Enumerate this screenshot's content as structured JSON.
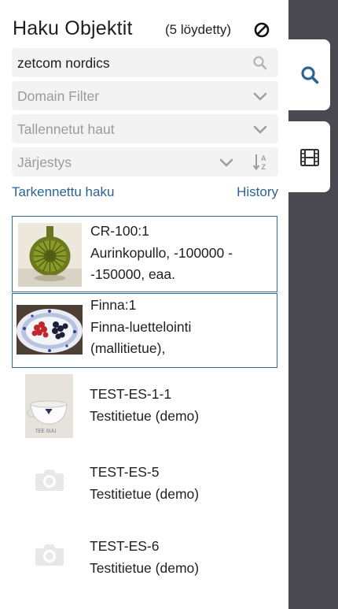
{
  "header": {
    "title": "Haku Objektit",
    "count": "(5 löydetty)",
    "clear_icon": "block-icon"
  },
  "search": {
    "value": "zetcom nordics",
    "icon": "search-icon"
  },
  "filters": {
    "domain_placeholder": "Domain Filter",
    "saved_placeholder": "Tallennetut haut",
    "sort_placeholder": "Järjestys",
    "chevron_icon": "chevron-down-icon",
    "sort_icon": "sort-alpha-icon"
  },
  "links": {
    "advanced": "Tarkennettu haku",
    "history": "History"
  },
  "results": [
    {
      "id": "CR-100:1",
      "line1": "Aurinkopullo, -100000 -",
      "line2": "-150000, eaa.",
      "selected": true,
      "thumb": "green-bottle"
    },
    {
      "id": "Finna:1",
      "line1": "Finna-luettelointi",
      "line2": "(mallitietue),",
      "selected": true,
      "thumb": "berries-plate"
    },
    {
      "id": "TEST-ES-1-1",
      "line1": "Testitietue (demo)",
      "line2": "",
      "selected": false,
      "thumb": "teacup"
    },
    {
      "id": "TEST-ES-5",
      "line1": "Testitietue (demo)",
      "line2": "",
      "selected": false,
      "thumb": "camera-placeholder"
    },
    {
      "id": "TEST-ES-6",
      "line1": "Testitietue (demo)",
      "line2": "",
      "selected": false,
      "thumb": "camera-placeholder"
    }
  ],
  "side_tabs": [
    {
      "icon": "search-icon",
      "active": true,
      "color": "#2a6494"
    },
    {
      "icon": "film-icon",
      "active": false,
      "color": "#333333"
    }
  ],
  "colors": {
    "accent": "#2a6494",
    "selected_border": "#2d6aa0",
    "backdrop": "#4a4952"
  }
}
